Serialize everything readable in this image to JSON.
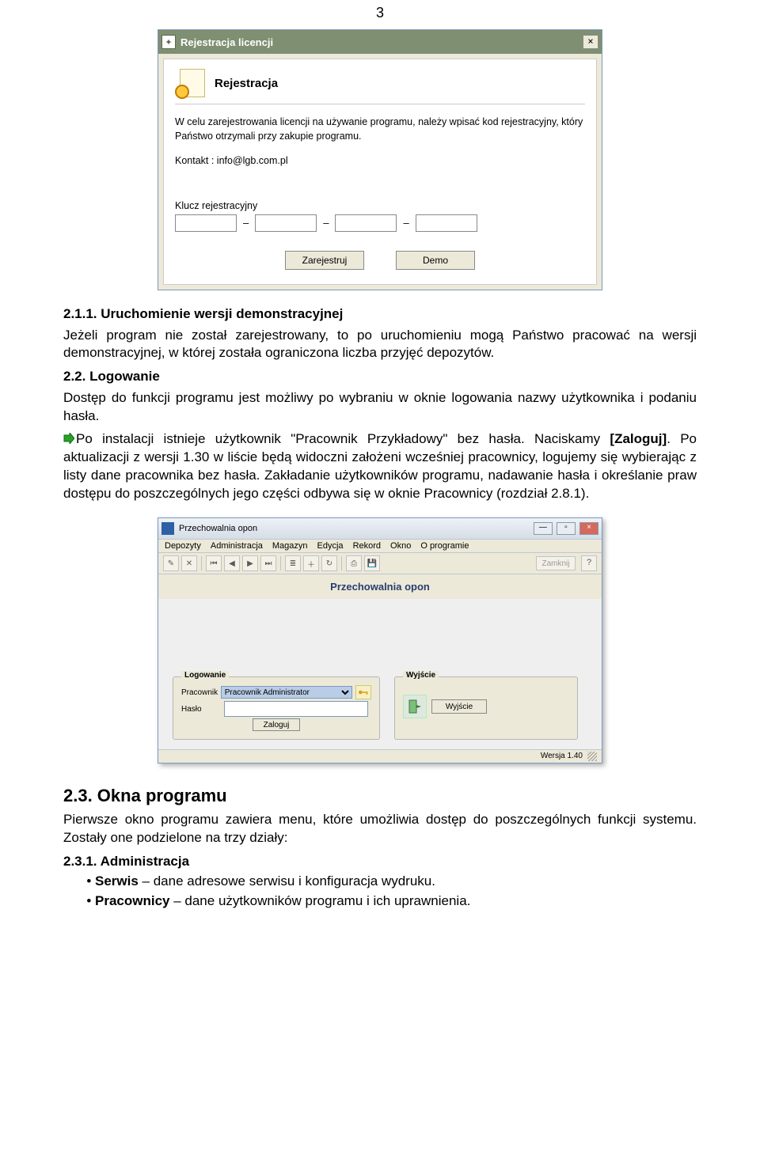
{
  "page_number": "3",
  "dlg1": {
    "titlebar": "Rejestracja licencji",
    "close_glyph": "×",
    "heading": "Rejestracja",
    "intro": "W celu zarejestrowania licencji na używanie programu, należy wpisać kod rejestracyjny, który Państwo otrzymali przy zakupie programu.",
    "contact": "Kontakt : info@lgb.com.pl",
    "key_label": "Klucz rejestracyjny",
    "dash": "–",
    "btn_register": "Zarejestruj",
    "btn_demo": "Demo"
  },
  "s211": {
    "heading": "2.1.1. Uruchomienie wersji demonstracyjnej",
    "p1": "Jeżeli program nie został zarejestrowany, to po uruchomieniu mogą Państwo pracować na wersji demonstracyjnej, w której została ograniczona liczba przyjęć depozytów."
  },
  "s22": {
    "heading": "2.2. Logowanie",
    "p1": "Dostęp do funkcji programu jest możliwy po wybraniu w oknie logowania nazwy użytkownika i podaniu hasła.",
    "p2a": "Po instalacji istnieje użytkownik \"Pracownik Przykładowy\" bez hasła. Naciskamy ",
    "p2b": "[Zaloguj]",
    "p2c": ". Po aktualizacji z wersji 1.30 w liście będą widoczni założeni wcześniej pracownicy, logujemy się wybierając z listy dane pracownika bez hasła. Zakładanie użytkowników programu, nadawanie hasła i określanie praw dostępu do poszczególnych jego części odbywa się w oknie Pracownicy (rozdział 2.8.1)."
  },
  "app": {
    "title": "Przechowalnia opon",
    "menu": [
      "Depozyty",
      "Administracja",
      "Magazyn",
      "Edycja",
      "Rekord",
      "Okno",
      "O programie"
    ],
    "toolbar_close": "Zamknij",
    "content_title": "Przechowalnia opon",
    "panel_login_title": "Logowanie",
    "lbl_pracownik": "Pracownik",
    "sel_pracownik": "Pracownik Administrator",
    "lbl_haslo": "Hasło",
    "btn_zaloguj": "Zaloguj",
    "panel_exit_title": "Wyjście",
    "btn_wyjscie": "Wyjście",
    "version": "Wersja 1.40"
  },
  "s23": {
    "heading": "2.3. Okna programu",
    "p1": "Pierwsze okno programu zawiera menu, które umożliwia dostęp do poszczególnych funkcji systemu. Zostały one podzielone na trzy działy:"
  },
  "s231": {
    "heading": "2.3.1. Administracja",
    "bullets": [
      {
        "name": "Serwis",
        "desc": " – dane adresowe serwisu i konfiguracja wydruku."
      },
      {
        "name": "Pracownicy",
        "desc": " – dane użytkowników programu i ich uprawnienia."
      }
    ]
  }
}
